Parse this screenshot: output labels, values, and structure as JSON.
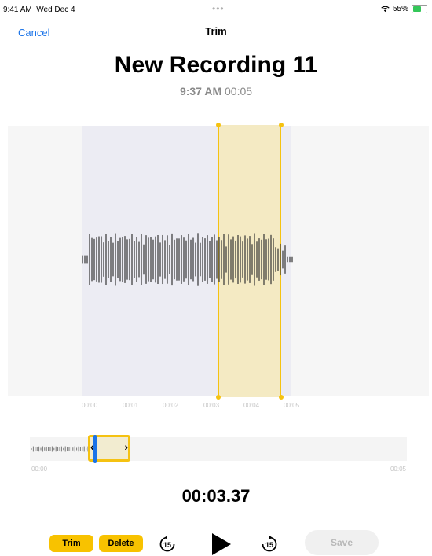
{
  "status": {
    "time": "9:41 AM",
    "date": "Wed Dec 4",
    "battery": "55%"
  },
  "nav": {
    "cancel": "Cancel",
    "title": "Trim"
  },
  "recording": {
    "title": "New Recording 11",
    "time": "9:37 AM",
    "duration": "00:05"
  },
  "waveform": {
    "ticks": [
      "00:00",
      "00:01",
      "00:02",
      "00:03",
      "00:04",
      "00:05"
    ],
    "selection_start_sec": 3.37,
    "selection_end_sec": 4.95
  },
  "mini": {
    "start": "00:00",
    "end": "00:05"
  },
  "current_time": "00:03.37",
  "controls": {
    "trim": "Trim",
    "delete": "Delete",
    "skip_back": "15",
    "skip_forward": "15",
    "save": "Save"
  },
  "colors": {
    "accent": "#f5c211",
    "link": "#1a73e8",
    "selection_fill": "#f4eac3",
    "playhead": "#1a73e8"
  }
}
